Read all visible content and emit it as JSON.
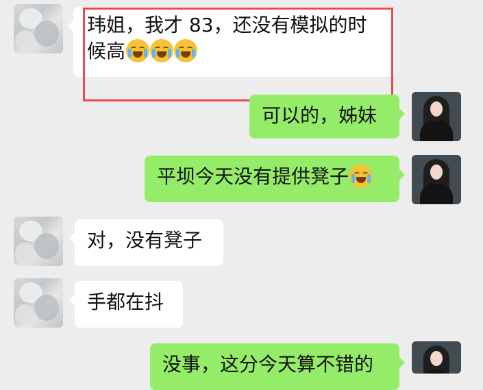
{
  "messages": [
    {
      "sender": "other",
      "text": "玮姐，我才 83，还没有模拟的时候高",
      "line1": "玮姐，我才 83，还没有模拟的时",
      "line2": "候高",
      "emoji": [
        "crying-face-emoji",
        "crying-face-emoji",
        "crying-face-emoji"
      ]
    },
    {
      "sender": "self",
      "text": "可以的，姊妹"
    },
    {
      "sender": "self",
      "text": "平坝今天没有提供凳子",
      "emoji": [
        "crying-face-emoji"
      ]
    },
    {
      "sender": "other",
      "text": "对，没有凳子"
    },
    {
      "sender": "other",
      "text": "手都在抖"
    },
    {
      "sender": "self",
      "text": "没事，这分今天算不错的"
    }
  ],
  "colors": {
    "background": "#ededed",
    "self_bubble": "#95ec69",
    "other_bubble": "#ffffff",
    "highlight_box": "#e74b4b",
    "emoji": "#f5c235"
  },
  "annotations": {
    "highlight": "red rectangle around first message"
  }
}
